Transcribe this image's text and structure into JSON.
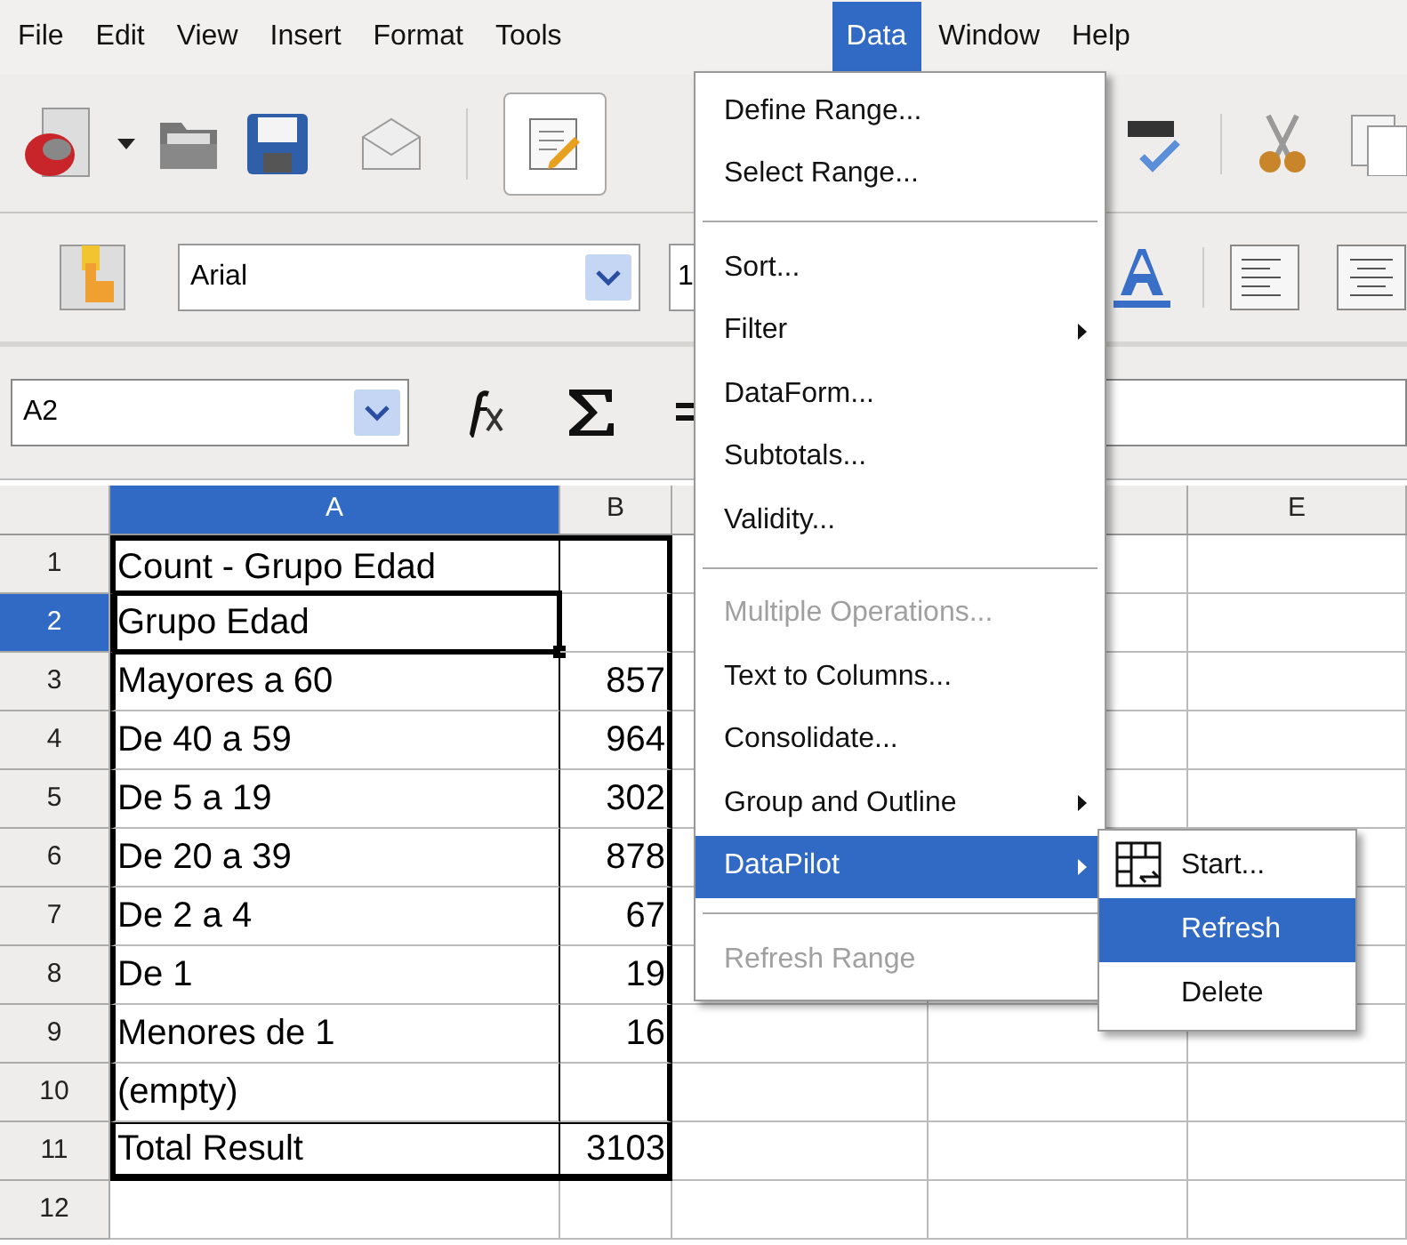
{
  "menubar": [
    {
      "label": "File",
      "selected": false
    },
    {
      "label": "Edit",
      "selected": false
    },
    {
      "label": "View",
      "selected": false
    },
    {
      "label": "Insert",
      "selected": false
    },
    {
      "label": "Format",
      "selected": false
    },
    {
      "label": "Tools",
      "selected": false
    },
    {
      "label": "Data",
      "selected": true
    },
    {
      "label": "Window",
      "selected": false
    },
    {
      "label": "Help",
      "selected": false
    }
  ],
  "formatting": {
    "font_name": "Arial",
    "font_size": "1"
  },
  "formula_bar": {
    "name_box": "A2"
  },
  "sheet": {
    "columns": [
      {
        "label": "A",
        "selected": true
      },
      {
        "label": "B",
        "selected": false
      },
      {},
      {},
      {
        "label": "E",
        "selected": false
      }
    ],
    "rows": [
      {
        "number": "1",
        "selected": false,
        "a": "Count - Grupo Edad"
      },
      {
        "number": "2",
        "selected": true,
        "a": "Grupo Edad"
      },
      {
        "number": "3",
        "selected": false,
        "a": "Mayores a 60",
        "b": "857"
      },
      {
        "number": "4",
        "selected": false,
        "a": "De 40 a 59",
        "b": "964"
      },
      {
        "number": "5",
        "selected": false,
        "a": "De 5 a 19",
        "b": "302"
      },
      {
        "number": "6",
        "selected": false,
        "a": "De 20 a 39",
        "b": "878"
      },
      {
        "number": "7",
        "selected": false,
        "a": "De 2 a 4",
        "b": "67"
      },
      {
        "number": "8",
        "selected": false,
        "a": "De 1",
        "b": "19"
      },
      {
        "number": "9",
        "selected": false,
        "a": "Menores de 1",
        "b": "16"
      },
      {
        "number": "10",
        "selected": false,
        "a": "(empty)"
      },
      {
        "number": "11",
        "selected": false,
        "kind": "total",
        "a": "Total Result",
        "b": "3103"
      },
      {
        "number": "12",
        "selected": false,
        "kind": "outside"
      }
    ]
  },
  "data_menu": [
    {
      "kind": "item",
      "label": "Define Range...",
      "disabled": false,
      "selected": false,
      "submenu": false
    },
    {
      "kind": "item",
      "label": "Select Range...",
      "disabled": false,
      "selected": false,
      "submenu": false
    },
    {
      "kind": "separator"
    },
    {
      "kind": "item",
      "label": "Sort...",
      "disabled": false,
      "selected": false,
      "submenu": false
    },
    {
      "kind": "item",
      "label": "Filter",
      "disabled": false,
      "selected": false,
      "submenu": true
    },
    {
      "kind": "item",
      "label": "DataForm...",
      "disabled": false,
      "selected": false,
      "submenu": false
    },
    {
      "kind": "item",
      "label": "Subtotals...",
      "disabled": false,
      "selected": false,
      "submenu": false
    },
    {
      "kind": "item",
      "label": "Validity...",
      "disabled": false,
      "selected": false,
      "submenu": false
    },
    {
      "kind": "separator"
    },
    {
      "kind": "item",
      "label": "Multiple Operations...",
      "disabled": true,
      "selected": false,
      "submenu": false
    },
    {
      "kind": "item",
      "label": "Text to Columns...",
      "disabled": false,
      "selected": false,
      "submenu": false
    },
    {
      "kind": "item",
      "label": "Consolidate...",
      "disabled": false,
      "selected": false,
      "submenu": false
    },
    {
      "kind": "item",
      "label": "Group and Outline",
      "disabled": false,
      "selected": false,
      "submenu": true
    },
    {
      "kind": "item",
      "label": "DataPilot",
      "disabled": false,
      "selected": true,
      "submenu": true
    },
    {
      "kind": "separator"
    },
    {
      "kind": "item",
      "label": "Refresh Range",
      "disabled": true,
      "selected": false,
      "submenu": false
    }
  ],
  "datapilot_submenu": [
    {
      "label": "Start...",
      "selected": false,
      "icon": true
    },
    {
      "label": "Refresh",
      "selected": true,
      "icon": false
    },
    {
      "label": "Delete",
      "selected": false,
      "icon": false
    }
  ]
}
